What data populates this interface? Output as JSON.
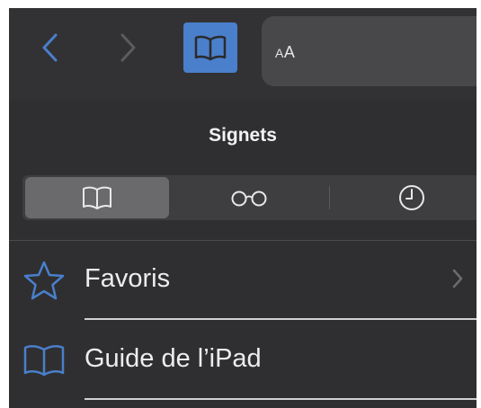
{
  "toolbar": {
    "back_icon": "chevron-left-icon",
    "forward_icon": "chevron-right-icon",
    "bookmarks_icon": "book-icon",
    "reader_small": "A",
    "reader_large": "A"
  },
  "panel": {
    "title": "Signets",
    "segments": [
      {
        "icon": "book-icon",
        "selected": true
      },
      {
        "icon": "glasses-icon",
        "selected": false
      },
      {
        "icon": "clock-icon",
        "selected": false
      }
    ]
  },
  "list": {
    "items": [
      {
        "label": "Favoris",
        "icon": "star-icon",
        "has_chevron": true
      },
      {
        "label": "Guide de l’iPad",
        "icon": "book-icon",
        "has_chevron": false
      }
    ]
  },
  "colors": {
    "accent": "#4a7fcb",
    "background": "#2f2f31",
    "text": "#ededef"
  }
}
